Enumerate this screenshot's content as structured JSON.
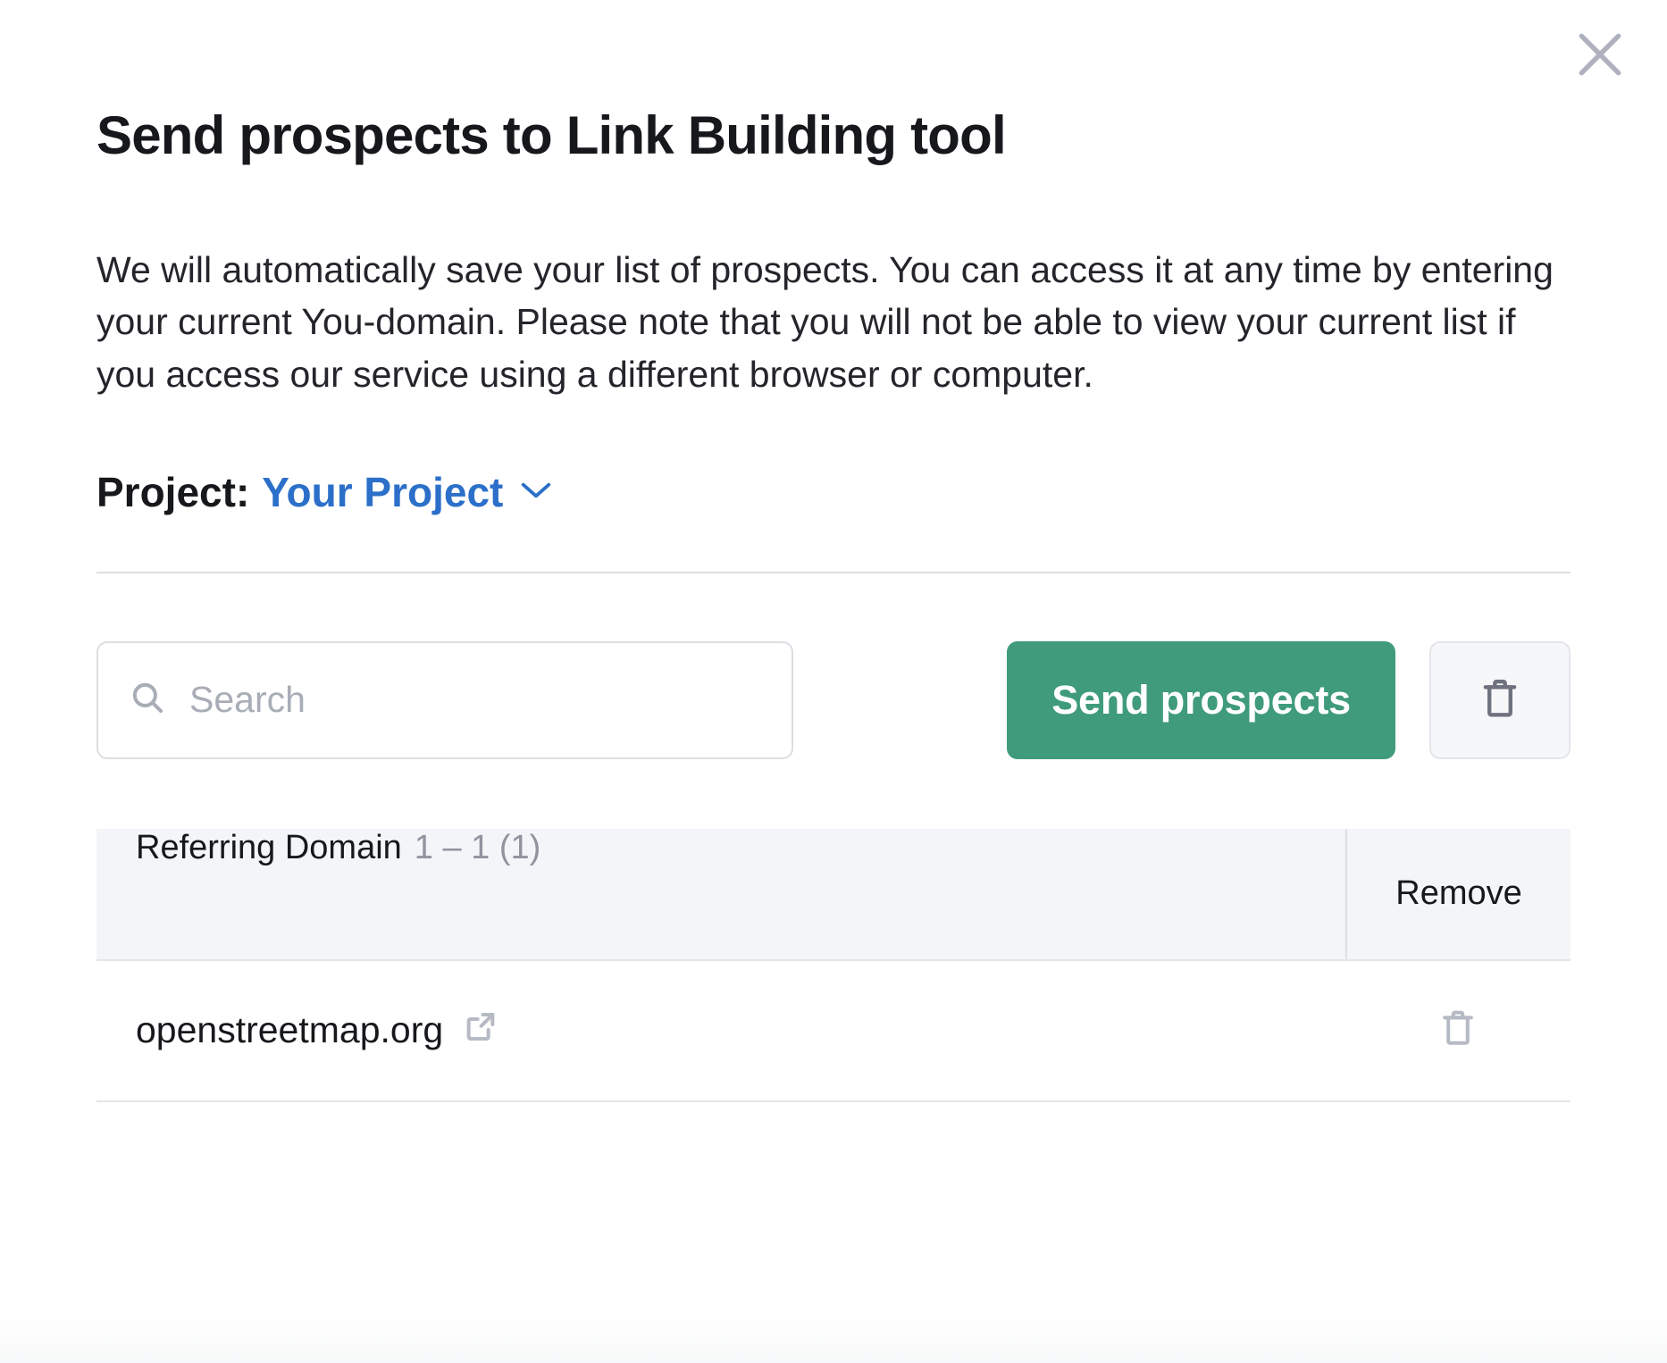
{
  "modal": {
    "close_icon": "close-icon",
    "title": "Send prospects to Link Building tool",
    "description": "We will automatically save your list of prospects. You can access it at any time by entering your current You-domain. Please note that you will not be able to view your current list if you access our service using a different browser or computer."
  },
  "project": {
    "label": "Project:",
    "value": "Your Project",
    "caret_icon": "chevron-down-icon"
  },
  "toolbar": {
    "search_placeholder": "Search",
    "search_value": "",
    "search_icon": "search-icon",
    "send_label": "Send prospects",
    "clear_all_icon": "trash-icon"
  },
  "table": {
    "headers": {
      "domain": "Referring Domain",
      "count": "1 – 1 (1)",
      "remove": "Remove"
    },
    "rows": [
      {
        "domain": "openstreetmap.org",
        "external_link_icon": "external-link-icon",
        "remove_icon": "trash-icon"
      }
    ]
  },
  "colors": {
    "accent_green": "#3f9b7c",
    "link_blue": "#2b6fc9",
    "text_dark": "#16181c",
    "muted_gray": "#8f949f",
    "border": "#dcdee3",
    "header_bg": "#f4f5f8"
  }
}
